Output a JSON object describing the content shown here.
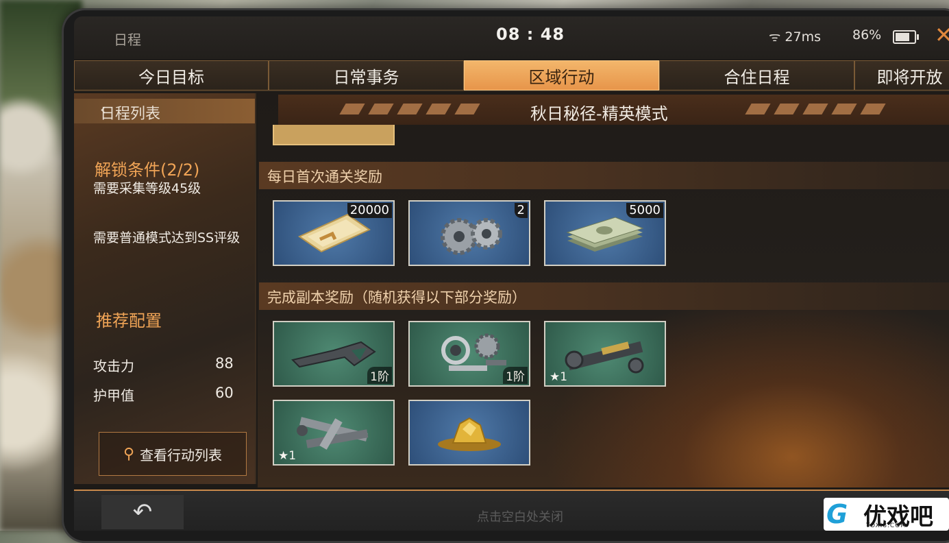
{
  "status_bar": {
    "title": "日程",
    "time": "08 : 48",
    "wifi": "27ms",
    "battery": "86%",
    "close_glyph": "✕"
  },
  "tabs": [
    {
      "label": "今日目标",
      "active": false
    },
    {
      "label": "日常事务",
      "active": false
    },
    {
      "label": "区域行动",
      "active": true
    },
    {
      "label": "合住日程",
      "active": false
    },
    {
      "label": "即将开放",
      "active": false
    }
  ],
  "sidebar": {
    "list_title": "日程列表",
    "unlock_title": "解锁条件(2/2)",
    "requirements": [
      "需要采集等级45级",
      "需要普通模式达到SS评级"
    ],
    "recommend_title": "推荐配置",
    "stats": [
      {
        "label": "攻击力",
        "value": "88"
      },
      {
        "label": "护甲值",
        "value": "60"
      }
    ],
    "view_button": "查看行动列表"
  },
  "main": {
    "mode_title": "秋日秘径-精英模式",
    "daily_section": "每日首次通关奖励",
    "daily_items": [
      {
        "icon": "ticket-icon",
        "count": "20000",
        "color": "blue"
      },
      {
        "icon": "gears-icon",
        "count": "2",
        "color": "blue"
      },
      {
        "icon": "cash-icon",
        "count": "5000",
        "color": "blue"
      }
    ],
    "complete_section": "完成副本奖励（随机获得以下部分奖励）",
    "complete_items": [
      {
        "icon": "rifle-stock-icon",
        "tier": "1阶",
        "color": "green"
      },
      {
        "icon": "bearing-parts-icon",
        "tier": "1阶",
        "color": "green"
      },
      {
        "icon": "pipe-parts-icon",
        "stars": "★1",
        "color": "green"
      },
      {
        "icon": "bolts-icon",
        "stars": "★1",
        "color": "green"
      },
      {
        "icon": "gold-ore-icon",
        "color": "blue"
      }
    ]
  },
  "bottom": {
    "back_glyph": "↶",
    "close_hint": "点击空白处关闭"
  },
  "watermark": {
    "brand": "优戏吧",
    "url": "YOXI8.COM"
  }
}
